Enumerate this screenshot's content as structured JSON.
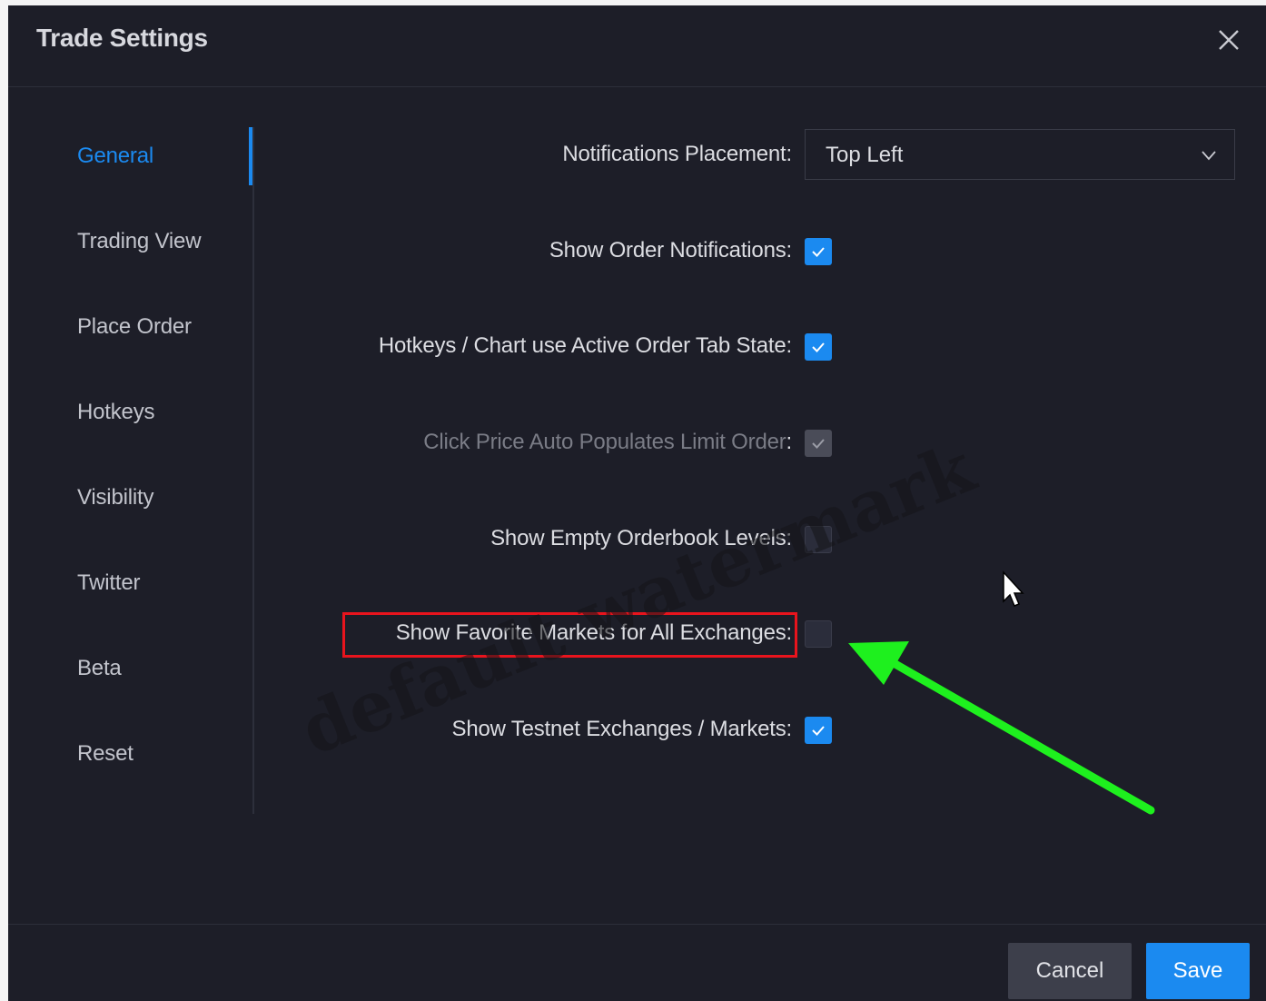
{
  "dialog": {
    "title": "Trade Settings"
  },
  "sidebar": {
    "items": [
      {
        "label": "General",
        "active": true
      },
      {
        "label": "Trading View",
        "active": false
      },
      {
        "label": "Place Order",
        "active": false
      },
      {
        "label": "Hotkeys",
        "active": false
      },
      {
        "label": "Visibility",
        "active": false
      },
      {
        "label": "Twitter",
        "active": false
      },
      {
        "label": "Beta",
        "active": false
      },
      {
        "label": "Reset",
        "active": false
      }
    ]
  },
  "settings": {
    "notifications_placement": {
      "label": "Notifications Placement",
      "value": "Top Left"
    },
    "rows": [
      {
        "label": "Show Order Notifications",
        "checked": true,
        "disabled": false
      },
      {
        "label": "Hotkeys / Chart use Active Order Tab State",
        "checked": true,
        "disabled": false
      },
      {
        "label": "Click Price Auto Populates Limit Order",
        "checked": true,
        "disabled": true
      },
      {
        "label": "Show Empty Orderbook Levels",
        "checked": false,
        "disabled": false
      },
      {
        "label": "Show Favorite Markets for All Exchanges",
        "checked": false,
        "disabled": false
      },
      {
        "label": "Show Testnet Exchanges / Markets",
        "checked": true,
        "disabled": false
      }
    ],
    "separator": ":"
  },
  "footer": {
    "cancel_label": "Cancel",
    "save_label": "Save"
  },
  "overlay": {
    "watermark_text": "default watermark",
    "highlight_color": "#e8141d",
    "arrow_color": "#1ef01e"
  },
  "colors": {
    "accent": "#1b8af0",
    "background": "#1d1e28"
  }
}
